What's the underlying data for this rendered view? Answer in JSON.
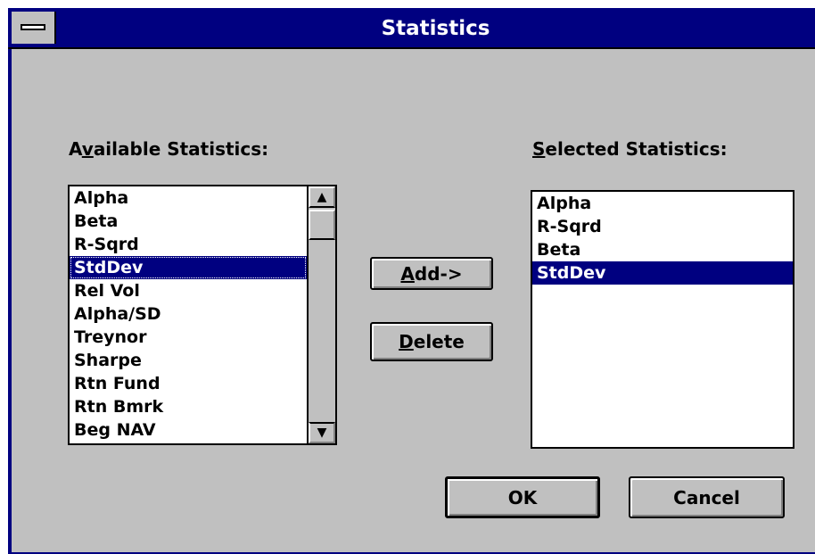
{
  "window": {
    "title": "Statistics"
  },
  "available": {
    "label_mnemonic_pre": "A",
    "label_mnemonic": "v",
    "label_rest": "ailable Statistics:",
    "items": [
      "Alpha",
      "Beta",
      "R-Sqrd",
      "StdDev",
      "Rel Vol",
      "Alpha/SD",
      "Treynor",
      "Sharpe",
      "Rtn Fund",
      "Rtn Bmrk",
      "Beg NAV"
    ],
    "selected_index": 3
  },
  "selected": {
    "label_mnemonic": "S",
    "label_rest": "elected Statistics:",
    "items": [
      "Alpha",
      "R-Sqrd",
      "Beta",
      "StdDev"
    ],
    "selected_index": 3
  },
  "buttons": {
    "add_mnemonic": "A",
    "add_rest": "dd->",
    "delete_mnemonic": "D",
    "delete_rest": "elete",
    "ok": "OK",
    "cancel": "Cancel"
  },
  "icons": {
    "scroll_up": "▲",
    "scroll_down": "▼"
  },
  "colors": {
    "title_bar": "#000080",
    "selection": "#000080",
    "face": "#c0c0c0"
  }
}
